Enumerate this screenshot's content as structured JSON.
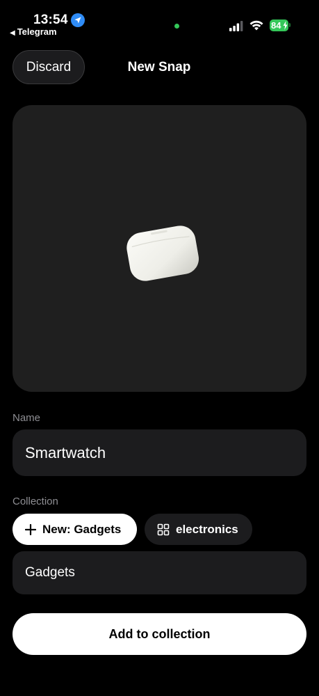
{
  "status_bar": {
    "time": "13:54",
    "back_app": "Telegram",
    "battery": "84",
    "accent_green": "#34c759",
    "location_color": "#2f8cf6"
  },
  "header": {
    "discard_label": "Discard",
    "title": "New Snap"
  },
  "photo": {
    "subject_icon": "earbuds-case"
  },
  "name": {
    "label": "Name",
    "value": "Smartwatch"
  },
  "collection": {
    "label": "Collection",
    "chips": [
      {
        "label": "New: Gadgets",
        "icon": "plus-icon",
        "selected": true
      },
      {
        "label": "electronics",
        "icon": "grid-icon",
        "selected": false
      }
    ],
    "value": "Gadgets"
  },
  "actions": {
    "add_label": "Add to collection"
  }
}
